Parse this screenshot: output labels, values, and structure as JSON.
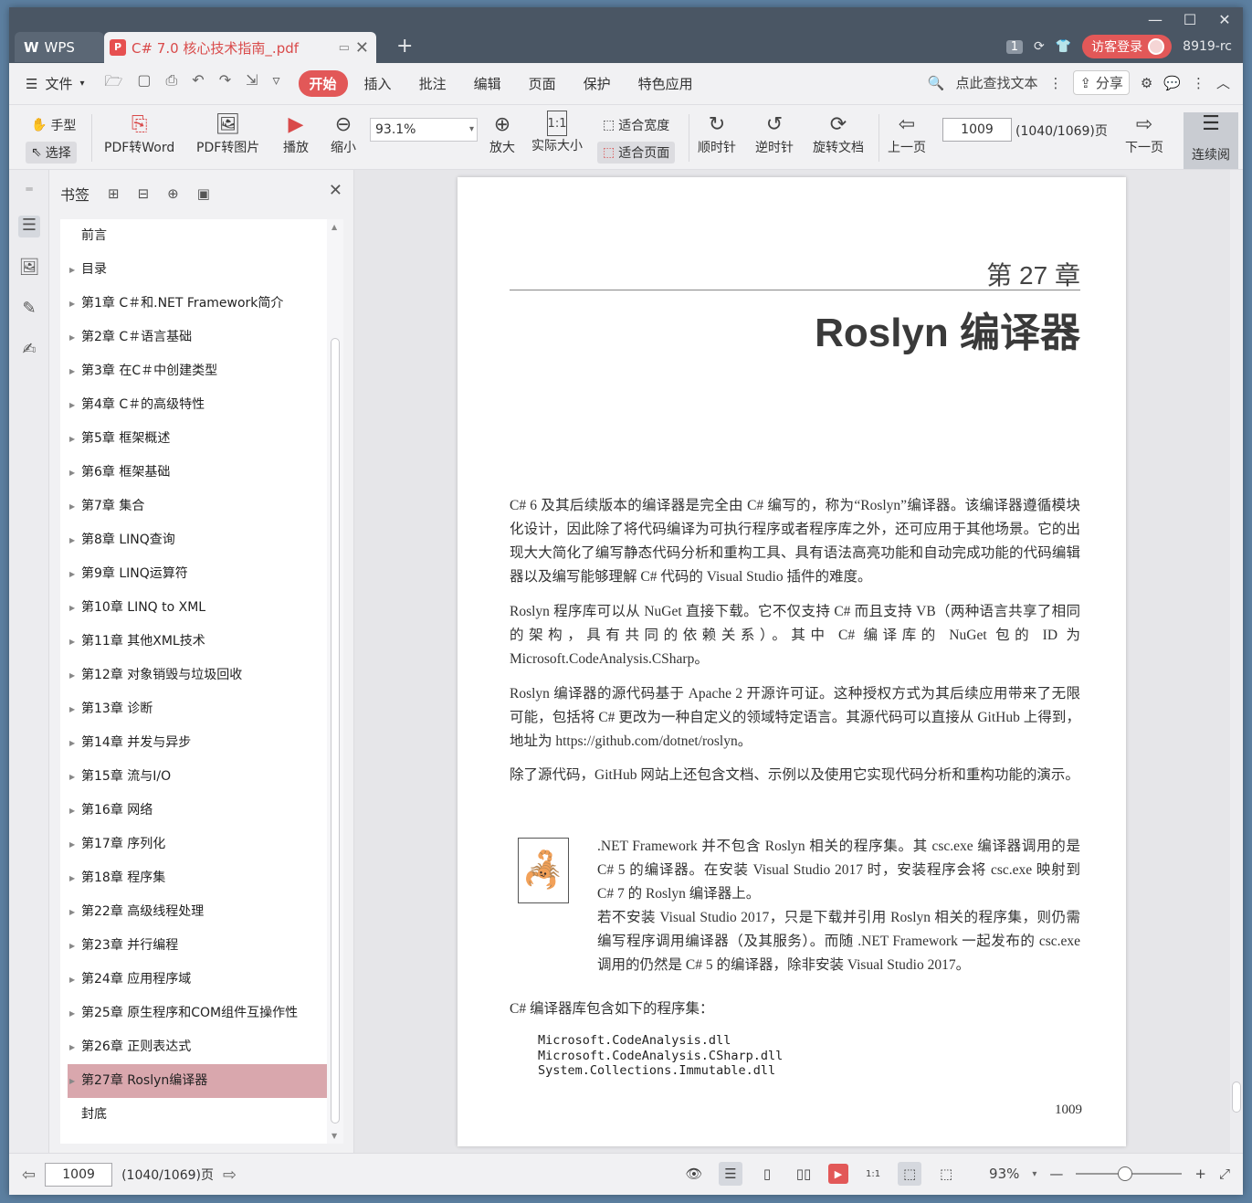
{
  "titlebar": {
    "app_tab": "WPS",
    "doc_tab": "C# 7.0 核心技术指南_.pdf",
    "page_badge": "1",
    "login": "访客登录",
    "user": "8919-rc"
  },
  "menubar": {
    "file": "文件",
    "tabs": [
      "开始",
      "插入",
      "批注",
      "编辑",
      "页面",
      "保护",
      "特色应用"
    ],
    "search": "点此查找文本",
    "share": "分享"
  },
  "toolbar": {
    "hand": "手型",
    "select": "选择",
    "pdf_word": "PDF转Word",
    "pdf_image": "PDF转图片",
    "play": "播放",
    "zoom_out": "缩小",
    "zoom_value": "93.1%",
    "zoom_in": "放大",
    "actual": "实际大小",
    "fit_width": "适合宽度",
    "fit_page": "适合页面",
    "cw": "顺时针",
    "ccw": "逆时针",
    "rotate_doc": "旋转文档",
    "prev": "上一页",
    "page_value": "1009",
    "page_total": "(1040/1069)页",
    "next": "下一页",
    "continuous": "连续阅"
  },
  "bookmarks": {
    "title": "书签",
    "items": [
      {
        "label": "前言",
        "arrow": false
      },
      {
        "label": "目录",
        "arrow": true
      },
      {
        "label": "第1章  C＃和.NET Framework简介",
        "arrow": true
      },
      {
        "label": "第2章  C＃语言基础",
        "arrow": true
      },
      {
        "label": "第3章  在C＃中创建类型",
        "arrow": true
      },
      {
        "label": "第4章  C＃的高级特性",
        "arrow": true
      },
      {
        "label": "第5章  框架概述",
        "arrow": true
      },
      {
        "label": "第6章  框架基础",
        "arrow": true
      },
      {
        "label": "第7章  集合",
        "arrow": true
      },
      {
        "label": "第8章  LINQ查询",
        "arrow": true
      },
      {
        "label": "第9章  LINQ运算符",
        "arrow": true
      },
      {
        "label": "第10章  LINQ to XML",
        "arrow": true
      },
      {
        "label": "第11章  其他XML技术",
        "arrow": true
      },
      {
        "label": "第12章  对象销毁与垃圾回收",
        "arrow": true
      },
      {
        "label": "第13章  诊断",
        "arrow": true
      },
      {
        "label": "第14章  并发与异步",
        "arrow": true
      },
      {
        "label": "第15章  流与I/O",
        "arrow": true
      },
      {
        "label": "第16章  网络",
        "arrow": true
      },
      {
        "label": "第17章  序列化",
        "arrow": true
      },
      {
        "label": "第18章  程序集",
        "arrow": true
      },
      {
        "label": "第22章  高级线程处理",
        "arrow": true
      },
      {
        "label": "第23章  并行编程",
        "arrow": true
      },
      {
        "label": "第24章  应用程序域",
        "arrow": true
      },
      {
        "label": "第25章  原生程序和COM组件互操作性",
        "arrow": true
      },
      {
        "label": "第26章  正则表达式",
        "arrow": true
      },
      {
        "label": "第27章  Roslyn编译器",
        "arrow": true,
        "selected": true
      },
      {
        "label": "封底",
        "arrow": false
      }
    ]
  },
  "page": {
    "chapter": "第 27 章",
    "title": "Roslyn 编译器",
    "p1": "C# 6 及其后续版本的编译器是完全由 C# 编写的，称为“Roslyn”编译器。该编译器遵循模块化设计，因此除了将代码编译为可执行程序或者程序库之外，还可应用于其他场景。它的出现大大简化了编写静态代码分析和重构工具、具有语法高亮功能和自动完成功能的代码编辑器以及编写能够理解 C# 代码的 Visual Studio 插件的难度。",
    "p2": "Roslyn 程序库可以从 NuGet 直接下载。它不仅支持 C# 而且支持 VB（两种语言共享了相同的架构，具有共同的依赖关系）。其中 C# 编译库的 NuGet 包的 ID 为 Microsoft.CodeAnalysis.CSharp。",
    "p3": "Roslyn 编译器的源代码基于 Apache 2 开源许可证。这种授权方式为其后续应用带来了无限可能，包括将 C# 更改为一种自定义的领域特定语言。其源代码可以直接从 GitHub 上得到，地址为 https://github.com/dotnet/roslyn。",
    "p4": "除了源代码，GitHub 网站上还包含文档、示例以及使用它实现代码分析和重构功能的演示。",
    "note1": ".NET Framework 并不包含 Roslyn 相关的程序集。其 csc.exe 编译器调用的是 C# 5 的编译器。在安装 Visual Studio 2017 时，安装程序会将 csc.exe 映射到 C# 7 的 Roslyn 编译器上。",
    "note2": "若不安装 Visual Studio 2017，只是下载并引用 Roslyn 相关的程序集，则仍需编写程序调用编译器（及其服务）。而随 .NET Framework 一起发布的 csc.exe 调用的仍然是 C# 5 的编译器，除非安装 Visual Studio 2017。",
    "p5": "C# 编译器库包含如下的程序集：",
    "code": [
      "Microsoft.CodeAnalysis.dll",
      "Microsoft.CodeAnalysis.CSharp.dll",
      "System.Collections.Immutable.dll"
    ],
    "number": "1009"
  },
  "status": {
    "page_value": "1009",
    "page_total": "(1040/1069)页",
    "zoom": "93%"
  }
}
